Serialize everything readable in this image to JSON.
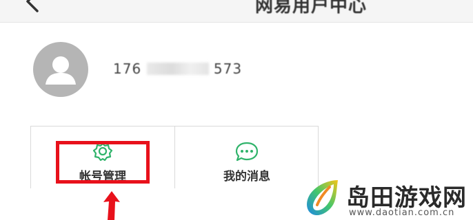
{
  "header": {
    "title": "网易用户中心"
  },
  "profile": {
    "phone_prefix": "176",
    "phone_suffix": "573"
  },
  "menu": {
    "items": [
      {
        "label": "帐号管理",
        "icon": "gear-icon"
      },
      {
        "label": "我的消息",
        "icon": "chat-bubble-icon"
      }
    ]
  },
  "watermark": {
    "title": "岛田游戏网",
    "url": "www.daotian.com.cn"
  },
  "colors": {
    "accent_green": "#2fb36a",
    "highlight_red": "#e8111b"
  }
}
